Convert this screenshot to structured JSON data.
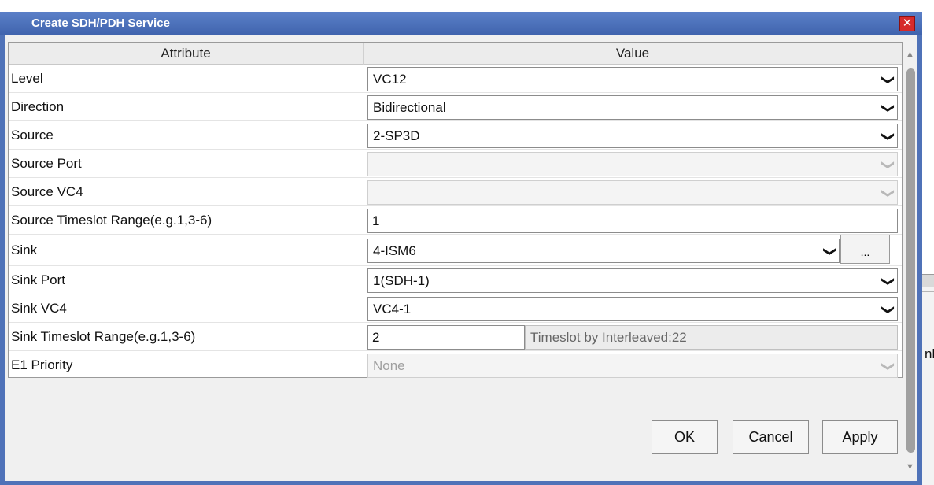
{
  "dialog": {
    "title": "Create SDH/PDH Service",
    "close_glyph": "✕"
  },
  "grid": {
    "header": {
      "attribute": "Attribute",
      "value": "Value"
    },
    "rows": [
      {
        "label": "Level",
        "value": "VC12"
      },
      {
        "label": "Direction",
        "value": "Bidirectional"
      },
      {
        "label": "Source",
        "value": "2-SP3D"
      },
      {
        "label": "Source Port",
        "value": ""
      },
      {
        "label": "Source VC4",
        "value": ""
      },
      {
        "label": "Source Timeslot Range(e.g.1,3-6)",
        "value": "1"
      },
      {
        "label": "Sink",
        "value": "4-ISM6",
        "button": "..."
      },
      {
        "label": "Sink Port",
        "value": "1(SDH-1)"
      },
      {
        "label": "Sink VC4",
        "value": "VC4-1"
      },
      {
        "label": "Sink Timeslot Range(e.g.1,3-6)",
        "value": "2",
        "note": "Timeslot by Interleaved:22"
      },
      {
        "label": "E1 Priority",
        "value": "None"
      }
    ]
  },
  "buttons": {
    "ok": "OK",
    "cancel": "Cancel",
    "apply": "Apply"
  },
  "background": {
    "fragment_text": "nk"
  },
  "icons": {
    "dropdown": "chevron-down-icon",
    "close": "close-icon",
    "scroll_up": "scroll-up-icon",
    "scroll_down": "scroll-down-icon"
  },
  "colors": {
    "titlebar": "#4f72b8",
    "close": "#d62a2a",
    "panel": "#f0f0f0"
  }
}
